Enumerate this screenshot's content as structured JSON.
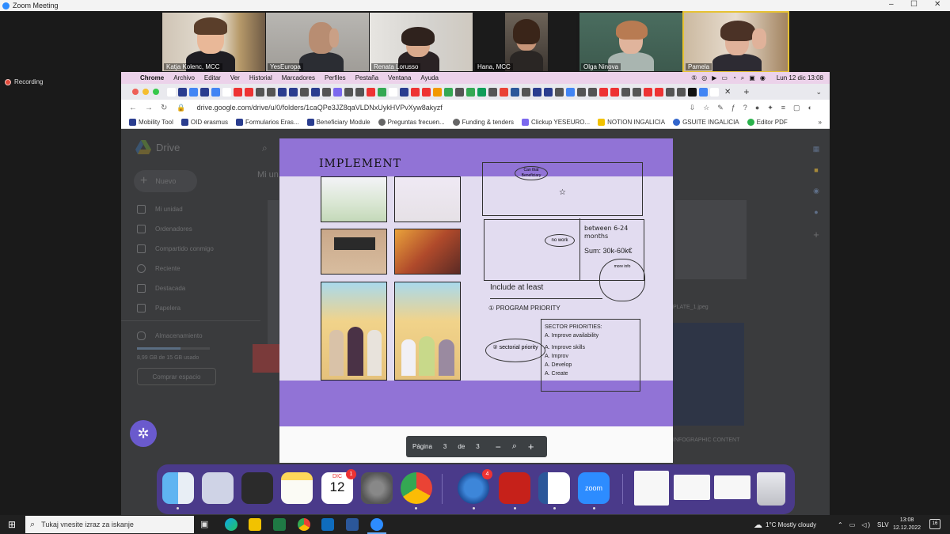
{
  "window": {
    "title": "Zoom Meeting"
  },
  "window_controls": [
    "–",
    "☐",
    "✕"
  ],
  "participants": [
    {
      "name": "Katja Kolenc, MCC"
    },
    {
      "name": "YesEuropa"
    },
    {
      "name": "Renata Lorusso"
    },
    {
      "name": "Hana, MCC"
    },
    {
      "name": "Olga Ninova"
    },
    {
      "name": "Pamela"
    }
  ],
  "recording_label": "Recording",
  "mac_menu": {
    "app": "Chrome",
    "items": [
      "Archivo",
      "Editar",
      "Ver",
      "Historial",
      "Marcadores",
      "Perfiles",
      "Pestaña",
      "Ventana",
      "Ayuda"
    ],
    "clock": "Lun 12 dic  13:08"
  },
  "browser": {
    "url": "drive.google.com/drive/u/0/folders/1caQPe3JZ8qaVLDNxUykHVPvXyw8akyzf",
    "bookmarks": [
      "Mobility Tool",
      "OID erasmus",
      "Formularios Eras...",
      "Beneficiary Module",
      "Preguntas frecuen...",
      "Funding & tenders",
      "Clickup YESEURO...",
      "NOTION INGALICIA",
      "GSUITE INGALICIA",
      "Editor PDF"
    ],
    "more_bookmarks": "»"
  },
  "drive": {
    "logo_text": "Drive",
    "new_button": "Nuevo",
    "nav": [
      "Mi unidad",
      "Ordenadores",
      "Compartido conmigo",
      "Reciente",
      "Destacada",
      "Papelera"
    ],
    "storage_label": "Almacenamiento",
    "storage_usage": "8,99 GB de 15 GB usado",
    "buy_storage": "Comprar espacio",
    "breadcrumb": "Mi un",
    "file_names": [
      "PLATE_1.jpeg",
      "INFOGRAPHIC CONTENT"
    ]
  },
  "pdf": {
    "heading": "IMPLEMENT",
    "pager": {
      "label": "Página",
      "current": "3",
      "of": "de",
      "total": "3"
    },
    "sketch_texts": {
      "bubble1": "Can that Beneficiary",
      "bubble2": "no work",
      "duration": "between 6-24 months",
      "sum": "Sum: 30k-60k€",
      "more_info": "more info",
      "include": "Include at least",
      "program_priority": "① PROGRAM PRIORITY",
      "sectoral": "② sectorial priority",
      "sector_priorities": "SECTOR PRIORITIES:",
      "items": [
        "A. Improve availability",
        "A. Improve skills",
        "A. Improv",
        "A. Develop",
        "A. Create"
      ]
    }
  },
  "dock": {
    "calendar_month": "DIC",
    "calendar_day": "12",
    "calendar_badge": "1",
    "thunderbird_badge": "4",
    "zoom_label": "zoom"
  },
  "taskbar": {
    "search_placeholder": "Tukaj vnesite izraz za iskanje",
    "weather": "1°C  Mostly cloudy",
    "lang": "SLV",
    "time": "13:08",
    "date": "12.12.2022",
    "notifications": "16"
  }
}
